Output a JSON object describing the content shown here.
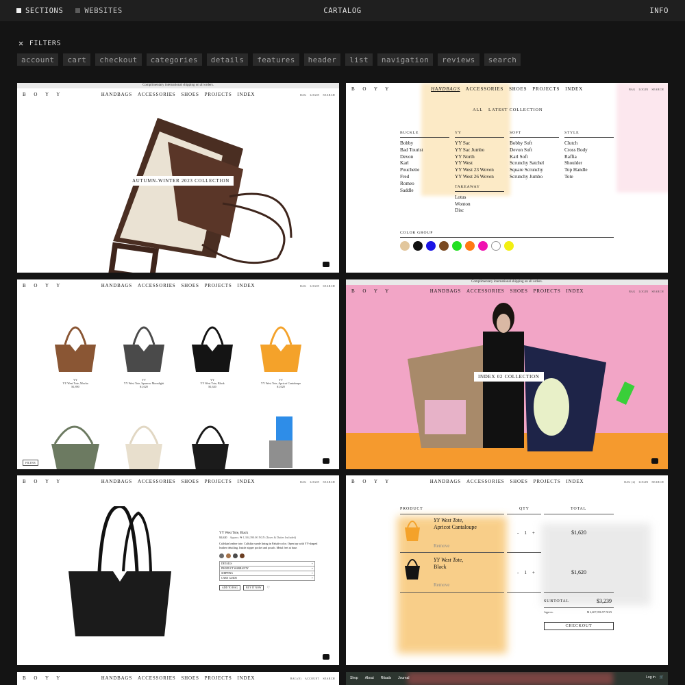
{
  "topbar": {
    "sections_label": "SECTIONS",
    "websites_label": "WEBSITES",
    "title": "CARTALOG",
    "info_label": "INFO"
  },
  "filters": {
    "title": "FILTERS",
    "close_icon": "close-icon",
    "tags": [
      "account",
      "cart",
      "checkout",
      "categories",
      "details",
      "features",
      "header",
      "list",
      "navigation",
      "reviews",
      "search"
    ]
  },
  "site": {
    "logo": "B O Y Y",
    "nav": [
      "HANDBAGS",
      "ACCESSORIES",
      "SHOES",
      "PROJECTS",
      "INDEX"
    ],
    "util": [
      "BAG",
      "LOGIN",
      "SEARCH"
    ],
    "shipping_note": "Complimentary international shipping on all orders."
  },
  "card1": {
    "pill": "AUTUMN-WINTER 2023 COLLECTION"
  },
  "card2": {
    "all": "ALL",
    "latest": "LATEST COLLECTION",
    "columns": [
      {
        "heading": "BUCKLE",
        "items": [
          "Bobby",
          "Bad Tourist",
          "Devon",
          "Karl",
          "Pouchette",
          "Fred",
          "Romeo",
          "Saddle"
        ]
      },
      {
        "heading": "YY",
        "items": [
          "YY Sac",
          "YY Sac Jumbo",
          "YY North",
          "YY West",
          "YY West 23 Woven",
          "YY West 26 Woven"
        ]
      },
      {
        "heading": "SOFT",
        "items": [
          "Bobby Soft",
          "Devon Soft",
          "Karl Soft",
          "Scrunchy Satchel",
          "Square Scrunchy",
          "Scrunchy Jumbo"
        ]
      },
      {
        "heading": "STYLE",
        "items": [
          "Clutch",
          "Cross Body",
          "Raffia",
          "Shoulder",
          "Top Handle",
          "Tote"
        ]
      }
    ],
    "takeaway": {
      "heading": "TAKEAWAY",
      "items": [
        "Lotus",
        "Wonton",
        "Disc"
      ]
    },
    "color_group": "COLOR GROUP",
    "colors": [
      "#e2c79d",
      "#111111",
      "#1a14e6",
      "#7a4a22",
      "#22e022",
      "#ff7a12",
      "#f012b0",
      "#ffffff",
      "#f2ef12"
    ]
  },
  "card3": {
    "products": [
      {
        "brand": "YY",
        "name": "YY West Tote, Mocha",
        "price": "$1,890",
        "color": "#8a5634"
      },
      {
        "brand": "YY",
        "name": "YY West Tote, Sparrow Moonlight",
        "price": "$1,620",
        "color": "#4a4a4a"
      },
      {
        "brand": "YY",
        "name": "YY West Tote, Black",
        "price": "$1,620",
        "color": "#141414"
      },
      {
        "brand": "YY",
        "name": "YY West Tote, Apricot Cantaloupe",
        "price": "$1,620",
        "color": "#f4a22a"
      }
    ],
    "filter": "FILTER"
  },
  "card4": {
    "pill": "INDEX 02 COLLECTION"
  },
  "card5": {
    "title": "YY West Tote, Black",
    "price": "$1,620",
    "approx": "Approx. ₦ 1,304,390.00 NGN (Taxes & Duties Included)",
    "desc": "Calfskin leather tote. Calfskin suede lining in Palude color. Open top with YY-shaped leather detailing. Inside zipper pocket and pouch. Metal feet at base.",
    "swatches": [
      "#6b6b6b",
      "#a5734a",
      "#4a4a4a",
      "#6b3e22"
    ],
    "accordion": [
      "DETAILS",
      "PRODUCT WARRANTY",
      "SHIPPING",
      "CARE GUIDE"
    ],
    "add_to_bag": "ADD TO BAG",
    "buy_now": "BUY IT NOW"
  },
  "card6": {
    "headers": {
      "product": "PRODUCT",
      "qty": "QTY",
      "total": "TOTAL"
    },
    "bag_label": "BAG (2)",
    "items": [
      {
        "name": "YY West Tote,",
        "variant": "Apricot Cantaloupe",
        "qty": "1",
        "total": "$1,620",
        "remove": "Remove",
        "color": "#f4a22a"
      },
      {
        "name": "YY West Tote,",
        "variant": "Black",
        "qty": "1",
        "total": "$1,620",
        "remove": "Remove",
        "color": "#141414"
      }
    ],
    "subtotal_label": "SUBTOTAL",
    "subtotal": "$3,239",
    "approx_label": "Approx.",
    "approx_value": "₦ 2,607,996.97 NGN",
    "checkout": "CHECKOUT",
    "minus": "-",
    "plus": "+"
  },
  "card7": {
    "util": [
      "BAG (0)",
      "ACCOUNT",
      "SEARCH"
    ]
  },
  "card8": {
    "nav": [
      "Shop",
      "About",
      "Rituals",
      "Journal"
    ],
    "login": "Log in"
  }
}
